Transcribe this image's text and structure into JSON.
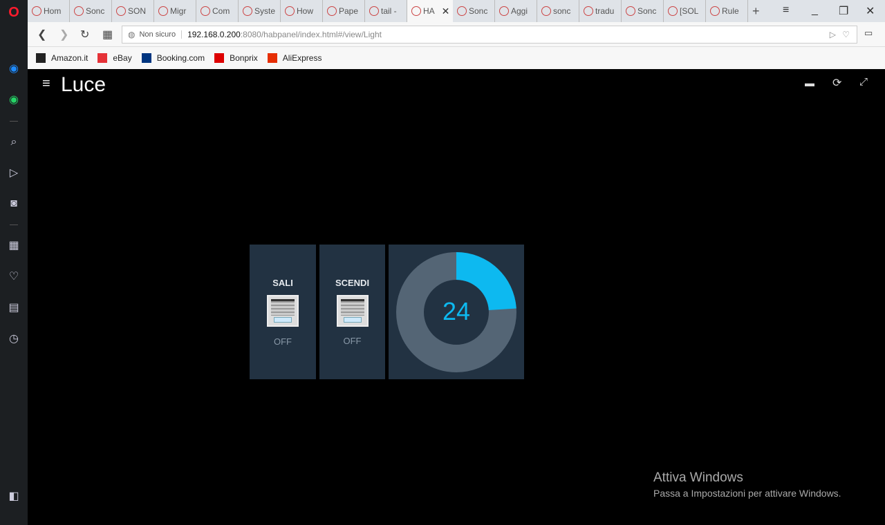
{
  "browser": {
    "tabs": [
      {
        "label": "Hom"
      },
      {
        "label": "Sonc"
      },
      {
        "label": "SON"
      },
      {
        "label": "Migr"
      },
      {
        "label": "Com"
      },
      {
        "label": "Syste"
      },
      {
        "label": "How"
      },
      {
        "label": "Pape"
      },
      {
        "label": "tail -"
      },
      {
        "label": "HA",
        "active": true
      },
      {
        "label": "Sonc"
      },
      {
        "label": "Aggi"
      },
      {
        "label": "sonc"
      },
      {
        "label": "tradu"
      },
      {
        "label": "Sonc"
      },
      {
        "label": "[SOL"
      },
      {
        "label": "Rule"
      }
    ],
    "security": "Non sicuro",
    "url_host": "192.168.0.200",
    "url_rest": ":8080/habpanel/index.html#/view/Light",
    "bookmarks": [
      {
        "label": "Amazon.it",
        "color": "#222"
      },
      {
        "label": "eBay",
        "color": "#e53238"
      },
      {
        "label": "Booking.com",
        "color": "#003580"
      },
      {
        "label": "Bonprix",
        "color": "#d00"
      },
      {
        "label": "AliExpress",
        "color": "#e62e04"
      }
    ]
  },
  "panel": {
    "title": "Luce",
    "widgets": [
      {
        "label": "SALI",
        "state": "OFF"
      },
      {
        "label": "SCENDI",
        "state": "OFF"
      }
    ],
    "gauge": {
      "value": "24",
      "percent": 24,
      "fill_color": "#0db9f0",
      "track_color": "#546575"
    }
  },
  "watermark": {
    "title": "Attiva Windows",
    "subtitle": "Passa a Impostazioni per attivare Windows."
  }
}
